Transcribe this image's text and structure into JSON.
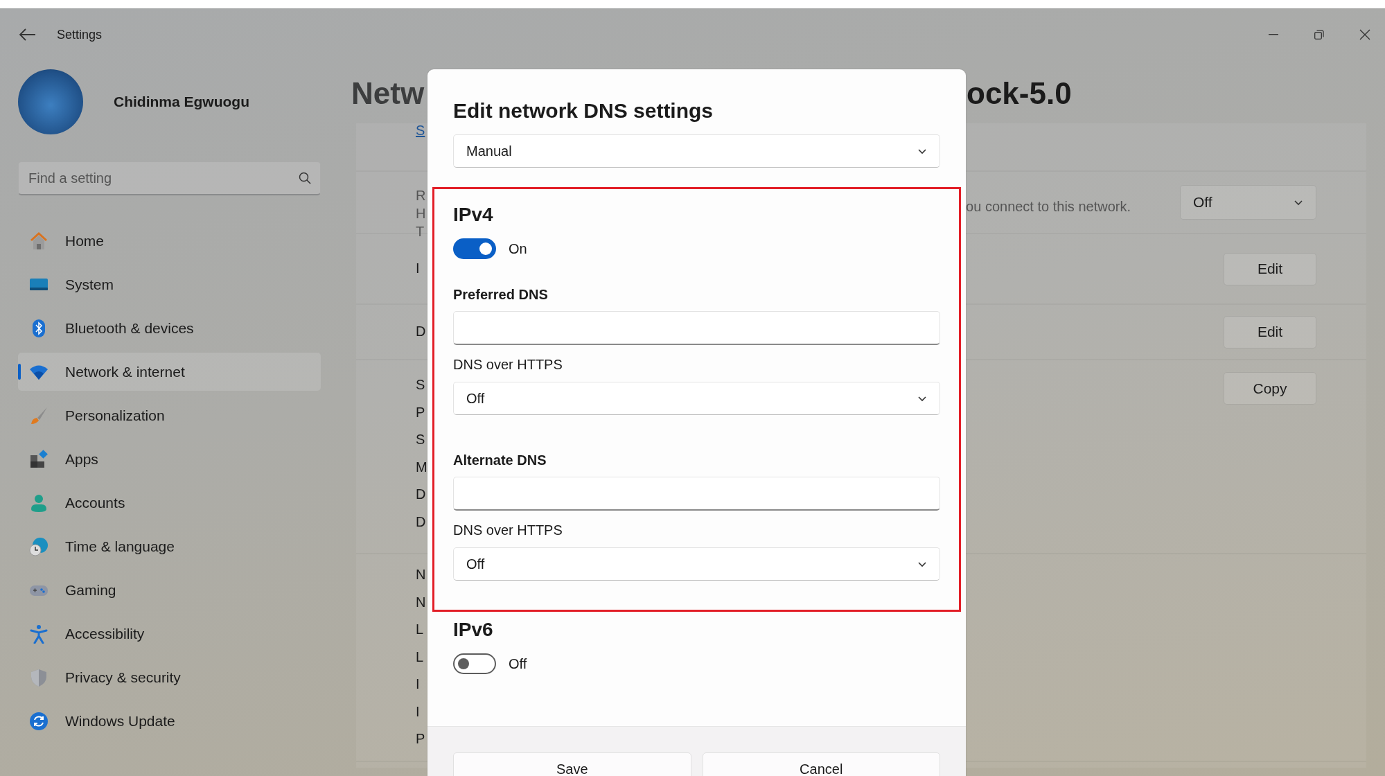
{
  "window": {
    "title": "Settings"
  },
  "user": {
    "name": "Chidinma Egwuogu"
  },
  "search": {
    "placeholder": "Find a setting"
  },
  "sidebar": {
    "items": [
      {
        "label": "Home",
        "selected": false
      },
      {
        "label": "System",
        "selected": false
      },
      {
        "label": "Bluetooth & devices",
        "selected": false
      },
      {
        "label": "Network & internet",
        "selected": true
      },
      {
        "label": "Personalization",
        "selected": false
      },
      {
        "label": "Apps",
        "selected": false
      },
      {
        "label": "Accounts",
        "selected": false
      },
      {
        "label": "Time & language",
        "selected": false
      },
      {
        "label": "Gaming",
        "selected": false
      },
      {
        "label": "Accessibility",
        "selected": false
      },
      {
        "label": "Privacy & security",
        "selected": false
      },
      {
        "label": "Windows Update",
        "selected": false
      }
    ]
  },
  "page": {
    "title_left": "Netw",
    "title_right": "ock-5.0",
    "rows": [
      {
        "kind": "link",
        "lines": [
          "S"
        ]
      },
      {
        "kind": "setting",
        "lines": [
          "R"
        ],
        "sublines": [
          "H",
          "T"
        ],
        "description": "ou connect to this network.",
        "control": {
          "kind": "dropdown",
          "value": "Off"
        }
      },
      {
        "kind": "setting",
        "lines": [
          "I"
        ],
        "control": {
          "kind": "button",
          "label": "Edit"
        }
      },
      {
        "kind": "setting",
        "lines": [
          "D"
        ],
        "control": {
          "kind": "button",
          "label": "Edit"
        }
      },
      {
        "kind": "setting",
        "lines": [
          "S",
          "P",
          "S",
          "M",
          "D",
          "D"
        ],
        "control": {
          "kind": "button",
          "label": "Copy"
        }
      },
      {
        "kind": "setting",
        "lines": [
          "N",
          "N",
          "L",
          "L",
          "I",
          "I",
          "P"
        ]
      }
    ]
  },
  "dialog": {
    "title": "Edit network DNS settings",
    "mode": "Manual",
    "sections": [
      {
        "heading": "IPv4",
        "on": true,
        "state_label": "On",
        "highlighted": true,
        "servers": [
          {
            "label": "Preferred DNS",
            "doh_label": "DNS over HTTPS",
            "doh_value": "Off"
          },
          {
            "label": "Alternate DNS",
            "doh_label": "DNS over HTTPS",
            "doh_value": "Off"
          }
        ]
      },
      {
        "heading": "IPv6",
        "on": false,
        "state_label": "Off"
      }
    ],
    "buttons": [
      "Save",
      "Cancel"
    ]
  }
}
